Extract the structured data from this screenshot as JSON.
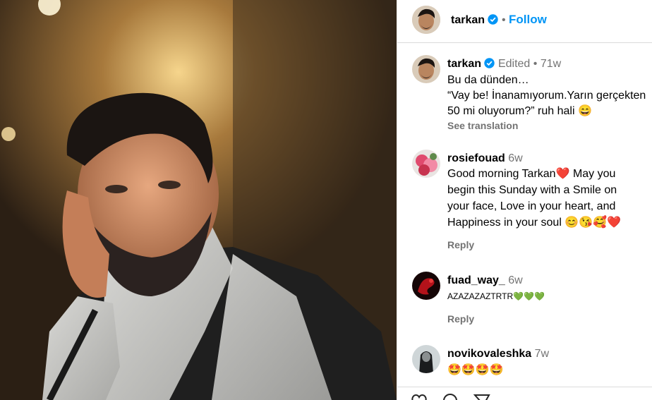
{
  "header": {
    "username": "tarkan",
    "dot": "•",
    "follow_label": "Follow"
  },
  "caption": {
    "username": "tarkan",
    "edited": "Edited",
    "dot": "•",
    "age": "71w",
    "line1": "Bu da dünden…",
    "line2": "“Vay be! İnanamıyorum.Yarın gerçekten",
    "line3": "50 mi oluyorum?” ruh hali 😄",
    "see_translation": "See translation"
  },
  "comments": [
    {
      "username": "rosiefouad",
      "age": "6w",
      "lines": [
        "Good morning Tarkan❤️  May you",
        "begin this Sunday with a Smile on",
        "your face, Love in your heart, and",
        "Happiness in your soul 😊😘🥰❤️"
      ],
      "reply": "Reply"
    },
    {
      "username": "fuad_way_",
      "age": "6w",
      "lines": [
        "AZAZAZAZTRTR💚💚💚"
      ],
      "reply": "Reply"
    },
    {
      "username": "novikovaleshka",
      "age": "7w",
      "lines": [
        "🤩🤩🤩🤩"
      ]
    }
  ],
  "colors": {
    "accent": "#0095f6",
    "muted": "#737373",
    "verified": "#0095f6"
  }
}
